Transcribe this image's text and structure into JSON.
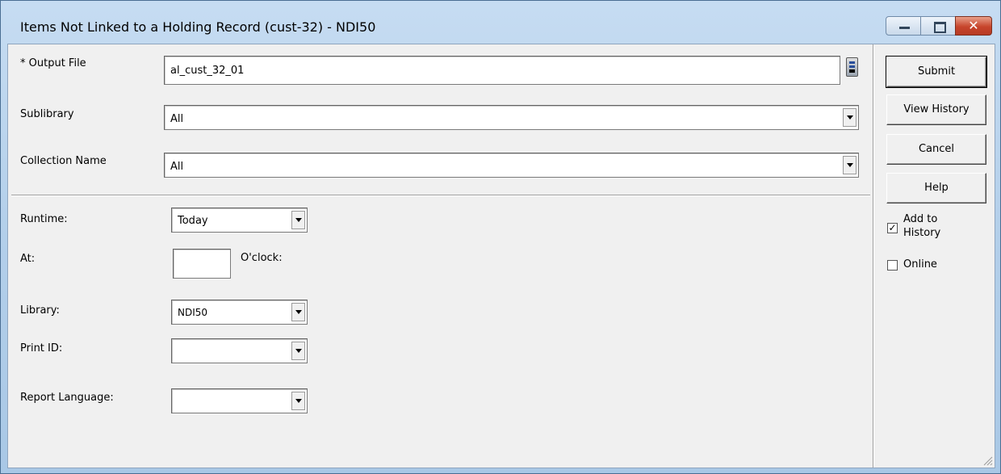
{
  "window": {
    "title": "Items Not Linked to a Holding Record (cust-32) - NDI50",
    "close_glyph": "✕"
  },
  "form": {
    "output_file": {
      "label": "* Output File",
      "value": "al_cust_32_01"
    },
    "sublibrary": {
      "label": "Sublibrary",
      "value": "All"
    },
    "collection_name": {
      "label": "Collection Name",
      "value": "All"
    },
    "runtime": {
      "label": "Runtime:",
      "value": "Today"
    },
    "at": {
      "label": "At:",
      "value": "",
      "suffix": "O'clock:"
    },
    "library": {
      "label": "Library:",
      "value": "NDI50"
    },
    "print_id": {
      "label": "Print ID:",
      "value": ""
    },
    "report_language": {
      "label": "Report Language:",
      "value": ""
    }
  },
  "buttons": {
    "submit": "Submit",
    "view_history": "View History",
    "cancel": "Cancel",
    "help": "Help"
  },
  "options": {
    "add_to_history": {
      "label_line1": "Add to",
      "label_line2": "History",
      "checked": true,
      "mark": "✓"
    },
    "online": {
      "label": "Online",
      "checked": false
    }
  },
  "colors": {
    "desktop": "#3c7fb8",
    "frame": "#b9d3ed",
    "close_button": "#c7452c",
    "dialog_bg": "#f0f0f0"
  },
  "icons": [
    "minimize-icon",
    "maximize-icon",
    "close-icon",
    "file-browse-icon",
    "chevron-down-icon",
    "checkmark-icon",
    "resize-grip-icon"
  ]
}
